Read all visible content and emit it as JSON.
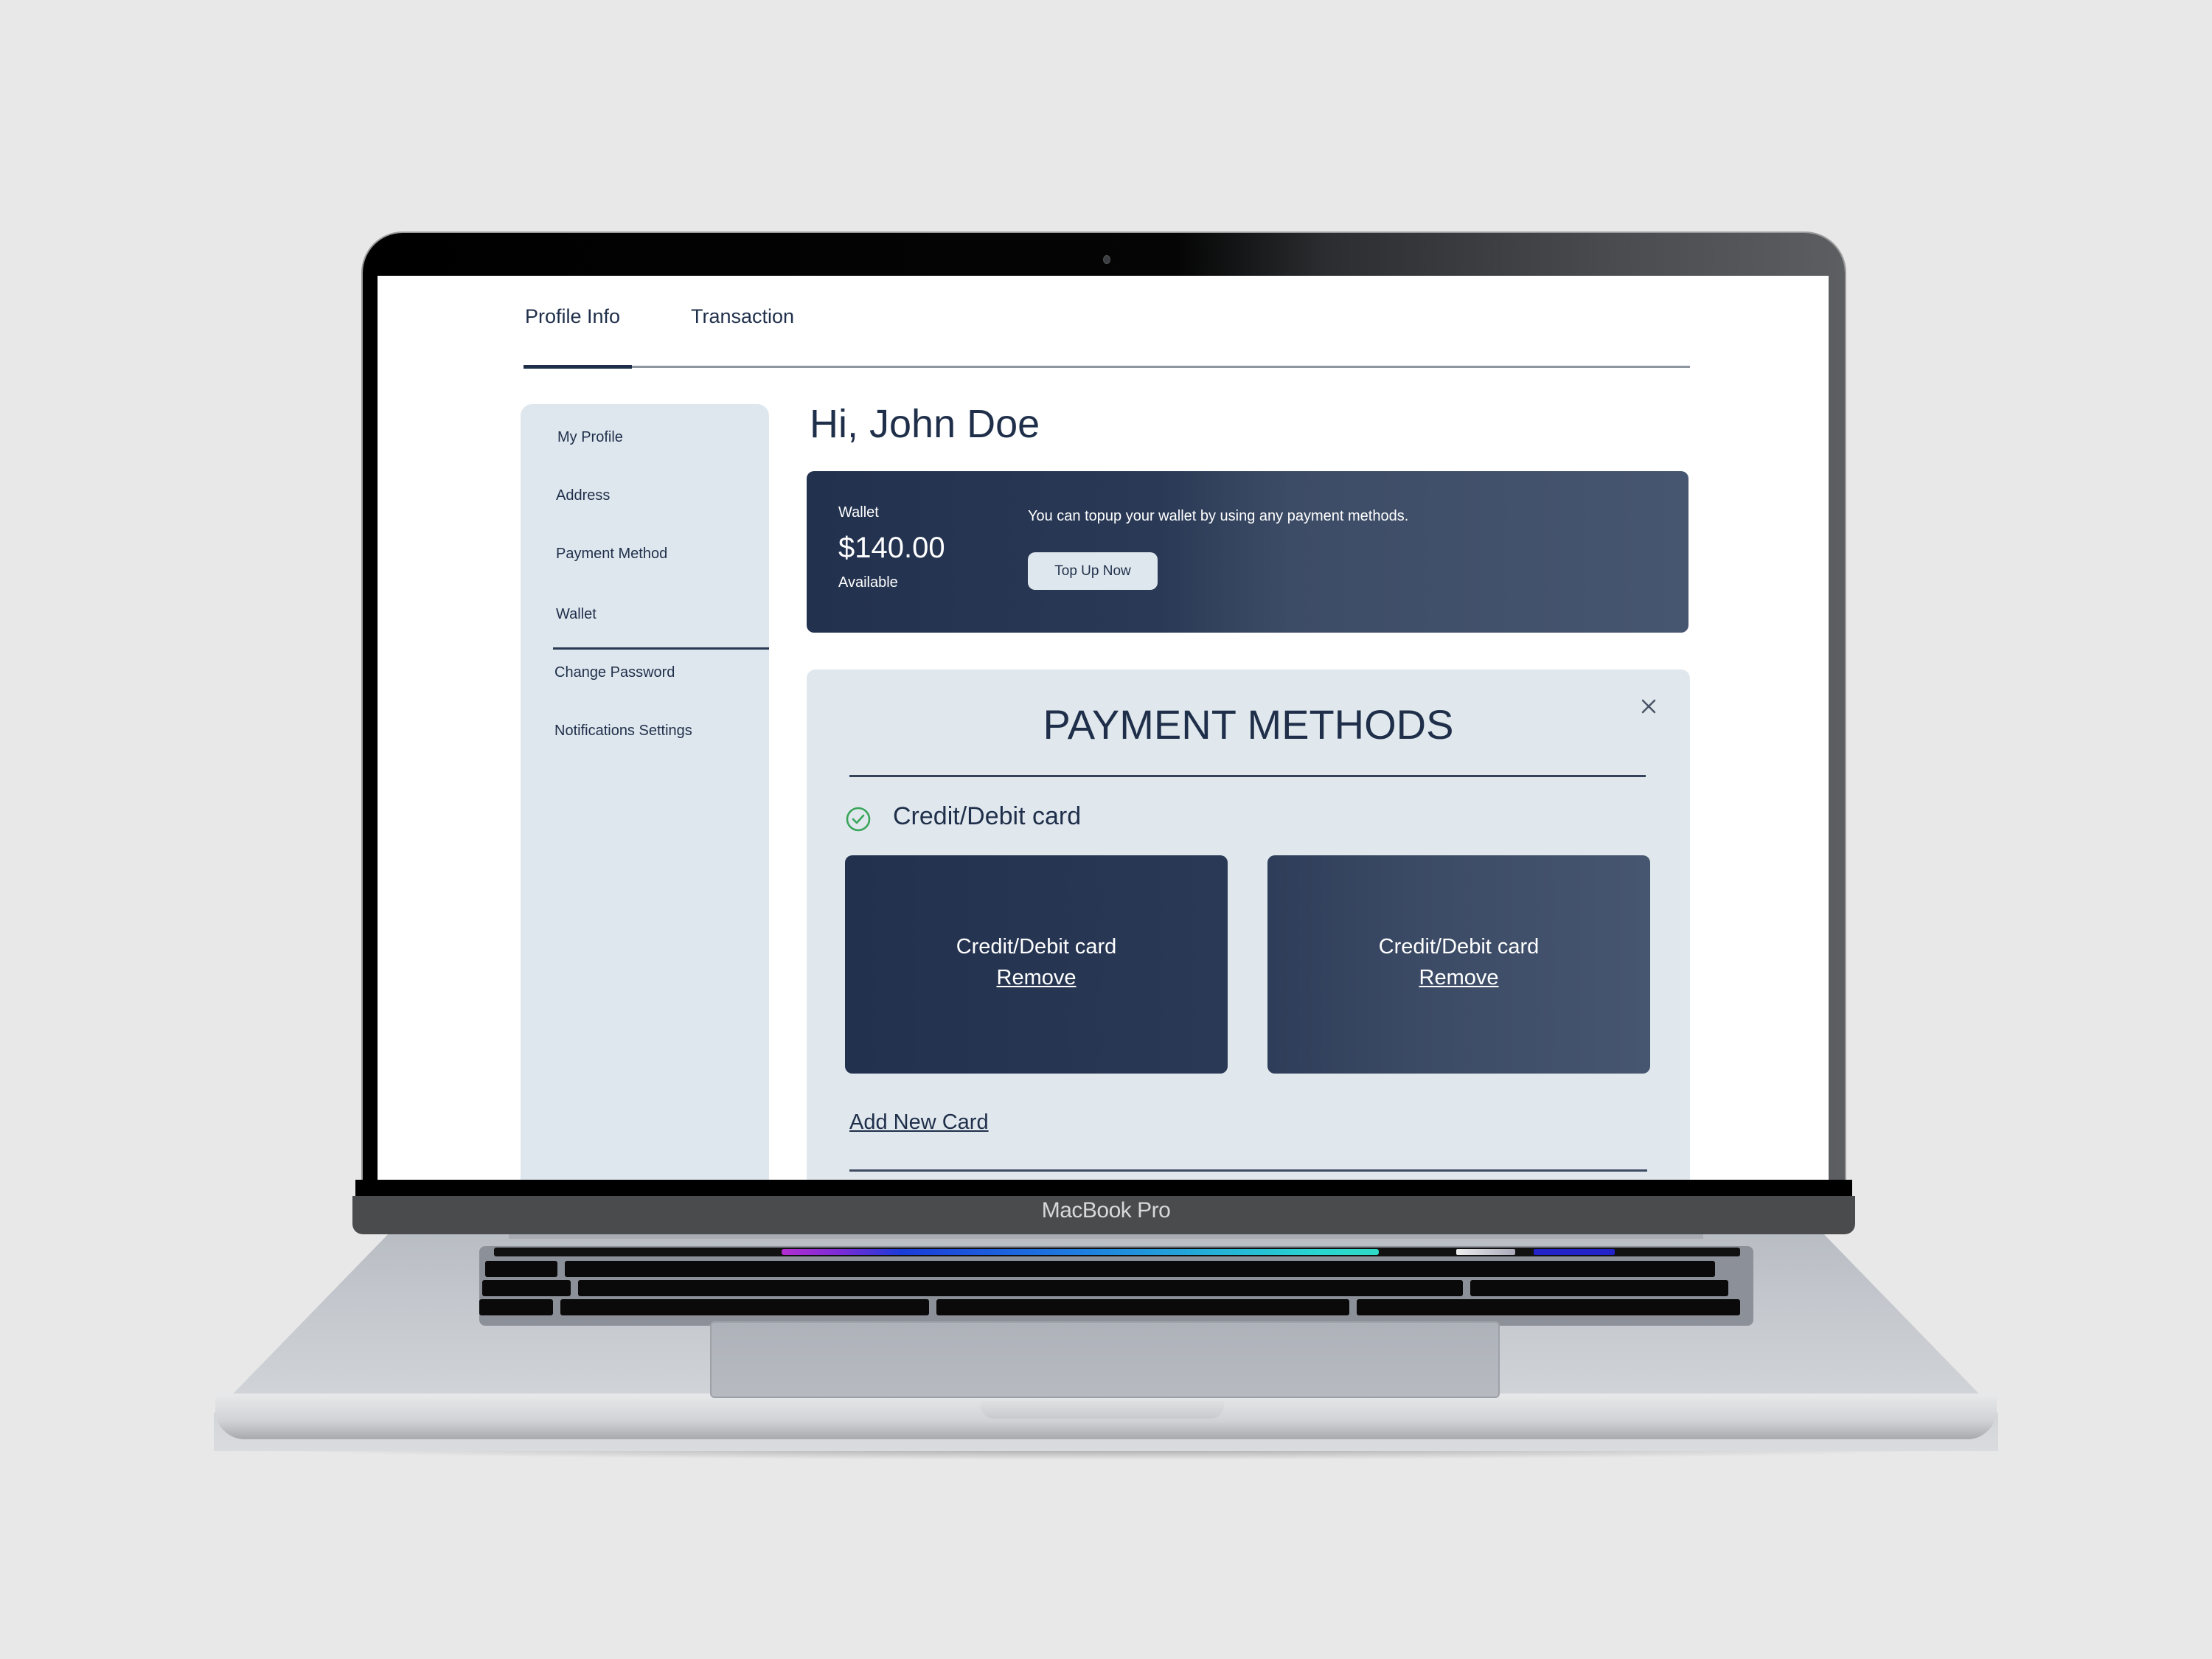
{
  "device": {
    "brand_label": "MacBook Pro"
  },
  "tabs": [
    {
      "label": "Profile Info",
      "active": true
    },
    {
      "label": "Transaction",
      "active": false
    }
  ],
  "sidebar": {
    "items": [
      {
        "label": "My Profile"
      },
      {
        "label": "Address"
      },
      {
        "label": "Payment Method"
      },
      {
        "label": "Wallet",
        "active": true
      },
      {
        "label": "Change Password"
      },
      {
        "label": "Notifications Settings"
      }
    ]
  },
  "main": {
    "greeting": "Hi, John Doe",
    "wallet": {
      "label": "Wallet",
      "amount": "$140.00",
      "status": "Available",
      "hint": "You can topup your wallet by using any payment methods.",
      "topup_label": "Top Up Now"
    },
    "payment_methods": {
      "title": "PAYMENT METHODS",
      "close_icon": "close-icon",
      "selected_type": "Credit/Debit card",
      "check_icon": "check-circle-icon",
      "cards": [
        {
          "label": "Credit/Debit card",
          "remove_label": "Remove"
        },
        {
          "label": "Credit/Debit card",
          "remove_label": "Remove"
        }
      ],
      "add_card_label": "Add New Card"
    }
  },
  "colors": {
    "primary_navy": "#1f2f4a",
    "panel_bg": "#e0e8ee",
    "success_green": "#3aa55a"
  }
}
